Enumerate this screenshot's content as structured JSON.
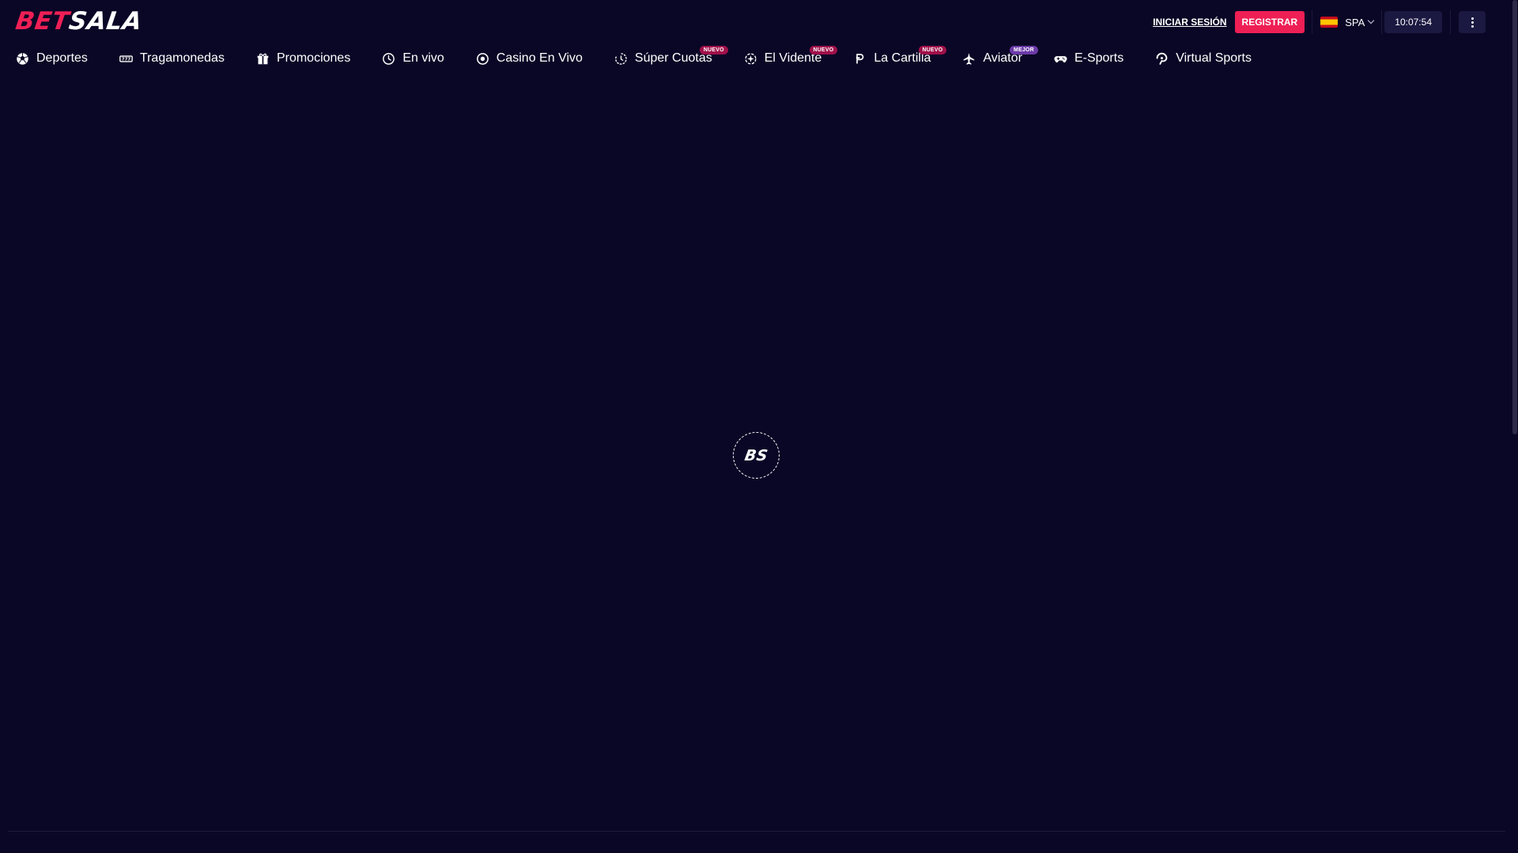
{
  "header": {
    "logo": {
      "part1": "BET",
      "part2": "SALA"
    },
    "login_label": "INICIAR SESIÓN",
    "register_label": "REGISTRAR",
    "language": "SPA",
    "time": "10:07:54"
  },
  "nav": {
    "items": [
      {
        "label": "Deportes",
        "icon": "soccer-ball-icon"
      },
      {
        "label": "Tragamonedas",
        "icon": "slot-machine-icon"
      },
      {
        "label": "Promociones",
        "icon": "gift-icon"
      },
      {
        "label": "En vivo",
        "icon": "clock-icon"
      },
      {
        "label": "Casino En Vivo",
        "icon": "casino-chip-icon"
      },
      {
        "label": "Súper Cuotas",
        "icon": "stopwatch-icon",
        "badge": "NUEVO"
      },
      {
        "label": "El Vidente",
        "icon": "crystal-ball-icon",
        "badge": "NUEVO"
      },
      {
        "label": "La Cartilla",
        "icon": "p-letter-icon",
        "badge": "NUEVO"
      },
      {
        "label": "Aviator",
        "icon": "airplane-icon",
        "badge": "MEJOR"
      },
      {
        "label": "E-Sports",
        "icon": "gamepad-icon"
      },
      {
        "label": "Virtual Sports",
        "icon": "virtual-icon"
      }
    ]
  },
  "loader": {
    "text": "BS"
  },
  "colors": {
    "background": "#0a0726",
    "accent": "#ee1f55",
    "badge_new": "#a0104a",
    "badge_best": "#6b3aa8",
    "panel": "#1b1841"
  }
}
